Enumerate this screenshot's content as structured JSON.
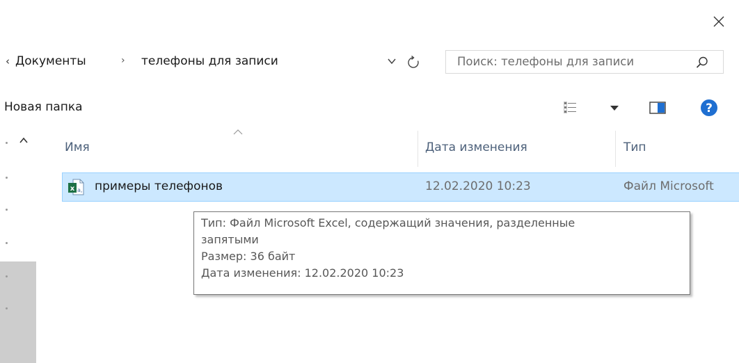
{
  "window": {
    "close_glyph": "✕"
  },
  "address": {
    "back_glyph": "‹",
    "crumbs": [
      "Документы",
      "телефоны для записи"
    ],
    "separator": "›"
  },
  "search": {
    "placeholder": "Поиск: телефоны для записи"
  },
  "toolbar": {
    "new_folder_label": "Новая папка"
  },
  "columns": {
    "name": "Имя",
    "date": "Дата изменения",
    "type": "Тип"
  },
  "files": [
    {
      "name": "примеры телефонов",
      "modified": "12.02.2020 10:23",
      "type": "Файл Microsoft"
    }
  ],
  "tooltip": {
    "lines": [
      "Тип: Файл Microsoft Excel, содержащий значения, разделенные",
      "запятыми",
      "Размер: 36 байт",
      "Дата изменения: 12.02.2020 10:23"
    ]
  },
  "colors": {
    "selection": "#cce8ff",
    "selection_border": "#99d1ff",
    "help_blue": "#1f6fd1",
    "excel_green": "#1e7145"
  },
  "icons": {
    "close": "close-icon",
    "refresh": "refresh-icon",
    "search": "search-icon",
    "view": "view-options-icon",
    "pane": "preview-pane-icon",
    "help": "help-icon",
    "file": "excel-csv-file-icon"
  }
}
